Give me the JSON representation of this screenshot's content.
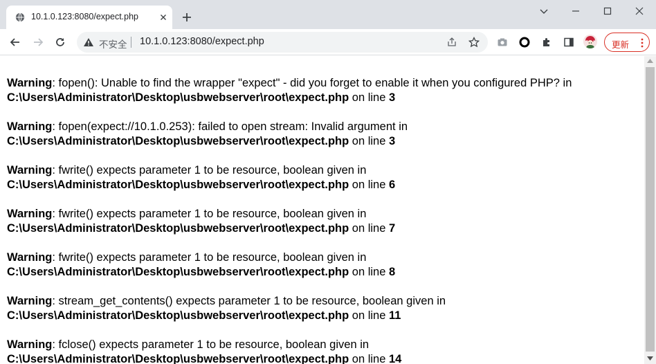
{
  "tab": {
    "title": "10.1.0.123:8080/expect.php"
  },
  "omnibox": {
    "security_label": "不安全",
    "url": "10.1.0.123:8080/expect.php"
  },
  "update_button": {
    "label": "更新"
  },
  "colors": {
    "update_red": "#d93025",
    "tabstrip_bg": "#dee1e6",
    "omnibox_bg": "#f1f3f4"
  },
  "icons": [
    "globe-icon",
    "close-icon",
    "plus-icon",
    "minimize-icon",
    "maximize-icon",
    "window-close-icon",
    "back-icon",
    "forward-icon",
    "reload-icon",
    "not-secure-icon",
    "share-icon",
    "star-icon",
    "camera-icon",
    "circle-icon",
    "extensions-icon",
    "sidepanel-icon",
    "profile-avatar",
    "more-icon"
  ],
  "warnings": [
    {
      "label": "Warning",
      "message": ": fopen(): Unable to find the wrapper \"expect\" - did you forget to enable it when you configured PHP? in",
      "path": "C:\\Users\\Administrator\\Desktop\\usbwebserver\\root\\expect.php",
      "on_line": " on line ",
      "line": "3"
    },
    {
      "label": "Warning",
      "message": ": fopen(expect://10.1.0.253): failed to open stream: Invalid argument in",
      "path": "C:\\Users\\Administrator\\Desktop\\usbwebserver\\root\\expect.php",
      "on_line": " on line ",
      "line": "3"
    },
    {
      "label": "Warning",
      "message": ": fwrite() expects parameter 1 to be resource, boolean given in",
      "path": "C:\\Users\\Administrator\\Desktop\\usbwebserver\\root\\expect.php",
      "on_line": " on line ",
      "line": "6"
    },
    {
      "label": "Warning",
      "message": ": fwrite() expects parameter 1 to be resource, boolean given in",
      "path": "C:\\Users\\Administrator\\Desktop\\usbwebserver\\root\\expect.php",
      "on_line": " on line ",
      "line": "7"
    },
    {
      "label": "Warning",
      "message": ": fwrite() expects parameter 1 to be resource, boolean given in",
      "path": "C:\\Users\\Administrator\\Desktop\\usbwebserver\\root\\expect.php",
      "on_line": " on line ",
      "line": "8"
    },
    {
      "label": "Warning",
      "message": ": stream_get_contents() expects parameter 1 to be resource, boolean given in",
      "path": "C:\\Users\\Administrator\\Desktop\\usbwebserver\\root\\expect.php",
      "on_line": " on line ",
      "line": "11"
    },
    {
      "label": "Warning",
      "message": ": fclose() expects parameter 1 to be resource, boolean given in",
      "path": "C:\\Users\\Administrator\\Desktop\\usbwebserver\\root\\expect.php",
      "on_line": " on line ",
      "line": "14"
    }
  ]
}
